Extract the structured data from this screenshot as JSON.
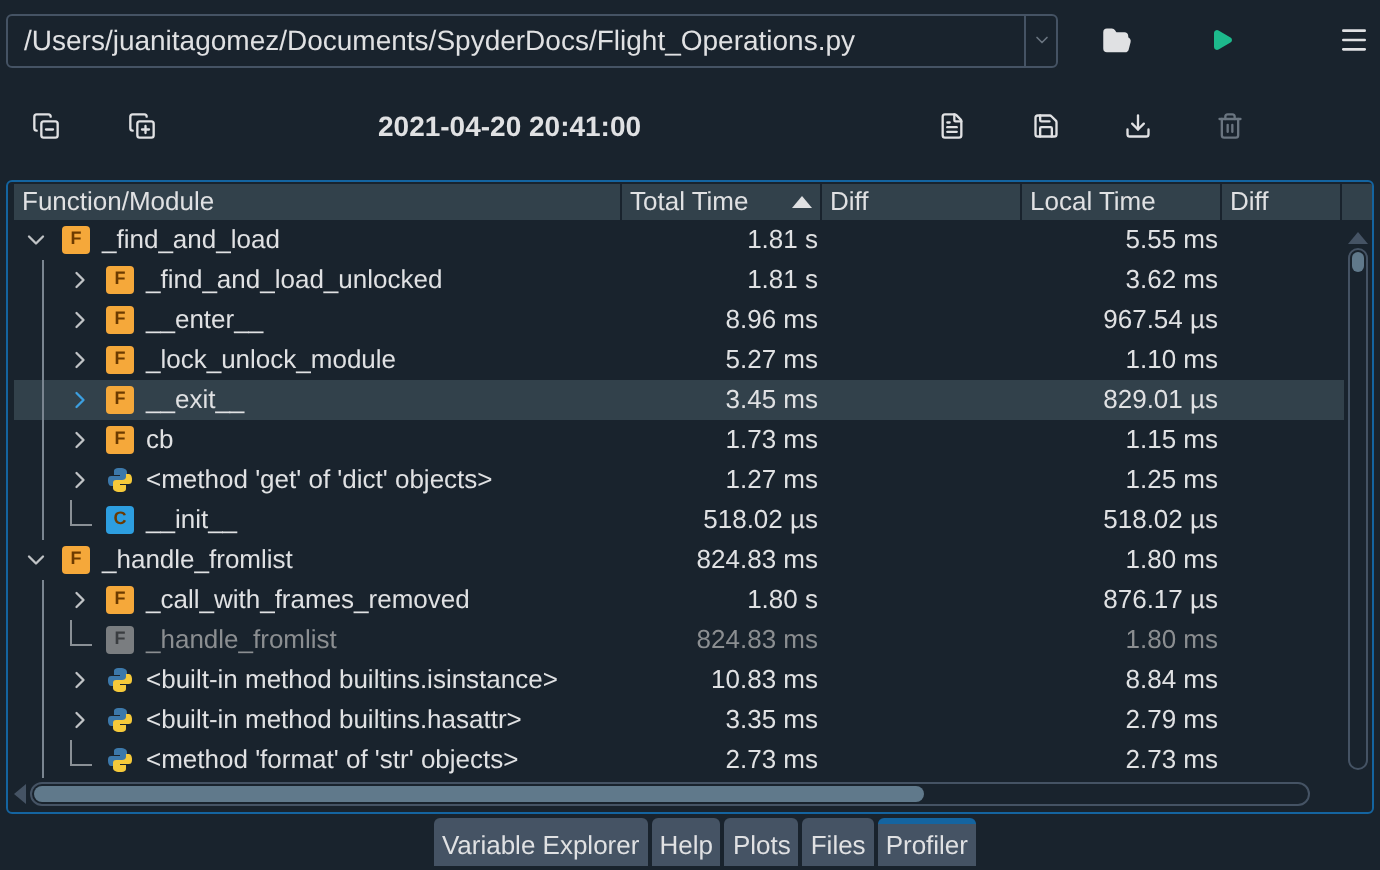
{
  "path_field": {
    "value": "/Users/juanitagomez/Documents/SpyderDocs/Flight_Operations.py"
  },
  "timestamp": "2021-04-20 20:41:00",
  "table": {
    "columns": [
      {
        "label": "Function/Module",
        "sorted": false
      },
      {
        "label": "Total Time",
        "sorted": true
      },
      {
        "label": "Diff",
        "sorted": false
      },
      {
        "label": "Local Time",
        "sorted": false
      },
      {
        "label": "Diff",
        "sorted": false
      }
    ],
    "rows": [
      {
        "name": "_find_and_load",
        "kind": "function",
        "badge": "F",
        "total_time": "1.81 s",
        "local_time": "5.55 ms",
        "expandable": true,
        "expanded": true,
        "selected": false,
        "dimmed": false,
        "children": [
          {
            "name": "_find_and_load_unlocked",
            "kind": "function",
            "badge": "F",
            "total_time": "1.81 s",
            "local_time": "3.62 ms",
            "expandable": true,
            "expanded": false,
            "selected": false,
            "dimmed": false
          },
          {
            "name": "__enter__",
            "kind": "function",
            "badge": "F",
            "total_time": "8.96 ms",
            "local_time": "967.54 µs",
            "expandable": true,
            "expanded": false,
            "selected": false,
            "dimmed": false
          },
          {
            "name": "_lock_unlock_module",
            "kind": "function",
            "badge": "F",
            "total_time": "5.27 ms",
            "local_time": "1.10 ms",
            "expandable": true,
            "expanded": false,
            "selected": false,
            "dimmed": false
          },
          {
            "name": "__exit__",
            "kind": "function",
            "badge": "F",
            "total_time": "3.45 ms",
            "local_time": "829.01 µs",
            "expandable": true,
            "expanded": false,
            "selected": true,
            "dimmed": false
          },
          {
            "name": "cb",
            "kind": "function",
            "badge": "F",
            "total_time": "1.73 ms",
            "local_time": "1.15 ms",
            "expandable": true,
            "expanded": false,
            "selected": false,
            "dimmed": false
          },
          {
            "name": "<method 'get' of 'dict' objects>",
            "kind": "builtin",
            "total_time": "1.27 ms",
            "local_time": "1.25 ms",
            "expandable": true,
            "expanded": false,
            "selected": false,
            "dimmed": false
          },
          {
            "name": "__init__",
            "kind": "class",
            "badge": "C",
            "total_time": "518.02 µs",
            "local_time": "518.02 µs",
            "expandable": false,
            "selected": false,
            "dimmed": false
          }
        ]
      },
      {
        "name": "_handle_fromlist",
        "kind": "function",
        "badge": "F",
        "total_time": "824.83 ms",
        "local_time": "1.80 ms",
        "expandable": true,
        "expanded": true,
        "selected": false,
        "dimmed": false,
        "children": [
          {
            "name": "_call_with_frames_removed",
            "kind": "function",
            "badge": "F",
            "total_time": "1.80 s",
            "local_time": "876.17 µs",
            "expandable": true,
            "expanded": false,
            "selected": false,
            "dimmed": false
          },
          {
            "name": "_handle_fromlist",
            "kind": "function",
            "badge": "F",
            "total_time": "824.83 ms",
            "local_time": "1.80 ms",
            "expandable": false,
            "selected": false,
            "dimmed": true
          },
          {
            "name": "<built-in method builtins.isinstance>",
            "kind": "builtin",
            "total_time": "10.83 ms",
            "local_time": "8.84 ms",
            "expandable": true,
            "expanded": false,
            "selected": false,
            "dimmed": false
          },
          {
            "name": "<built-in method builtins.hasattr>",
            "kind": "builtin",
            "total_time": "3.35 ms",
            "local_time": "2.79 ms",
            "expandable": true,
            "expanded": false,
            "selected": false,
            "dimmed": false
          },
          {
            "name": "<method 'format' of 'str' objects>",
            "kind": "builtin",
            "total_time": "2.73 ms",
            "local_time": "2.73 ms",
            "expandable": false,
            "selected": false,
            "dimmed": false
          }
        ]
      }
    ]
  },
  "tabs": [
    {
      "label": "Variable Explorer",
      "selected": false
    },
    {
      "label": "Help",
      "selected": false
    },
    {
      "label": "Plots",
      "selected": false
    },
    {
      "label": "Files",
      "selected": false
    },
    {
      "label": "Profiler",
      "selected": true
    }
  ]
}
